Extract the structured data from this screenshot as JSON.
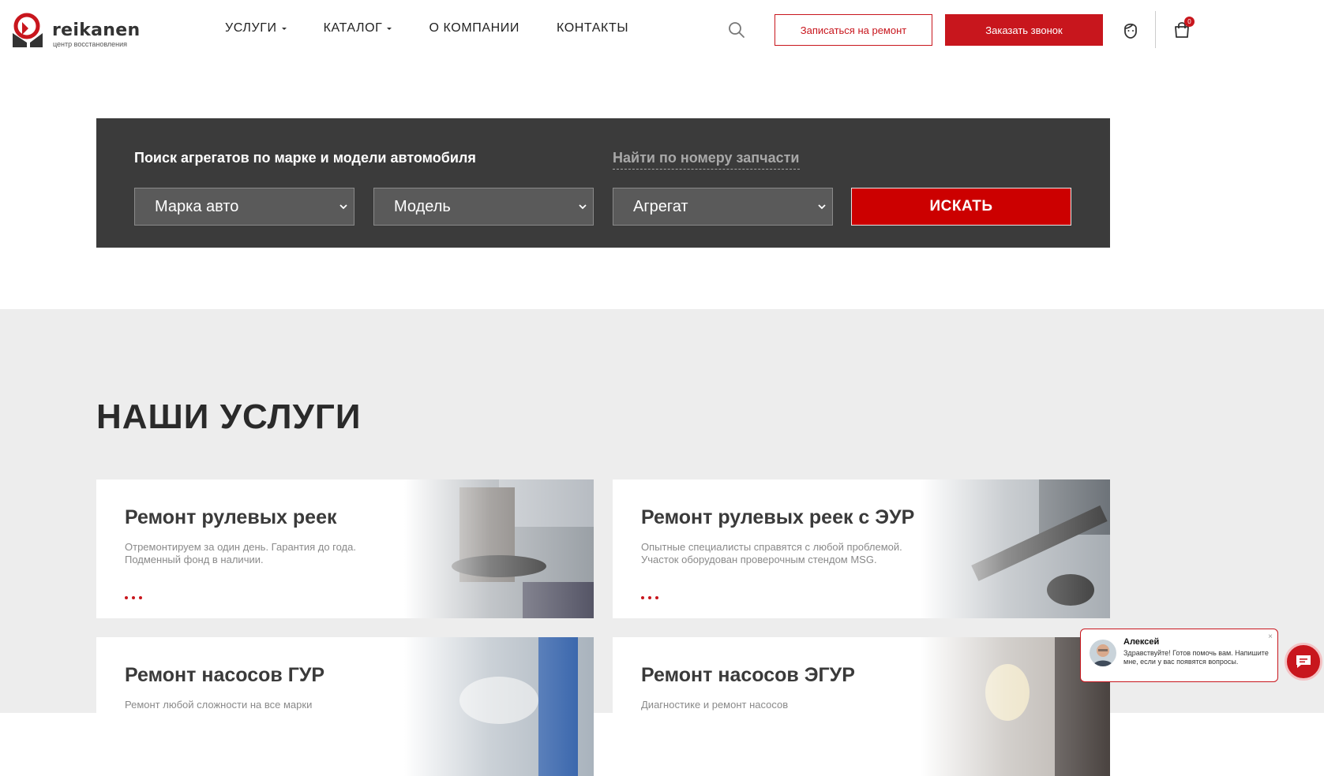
{
  "brand": {
    "name": "reikanen",
    "tagline": "центр восстановления",
    "accent_color": "#c8161d"
  },
  "nav": {
    "items": [
      {
        "label": "УСЛУГИ",
        "has_dropdown": true
      },
      {
        "label": "КАТАЛОГ",
        "has_dropdown": true
      },
      {
        "label": "О КОМПАНИИ",
        "has_dropdown": false
      },
      {
        "label": "КОНТАКТЫ",
        "has_dropdown": false
      }
    ]
  },
  "header": {
    "icons": [
      "search-icon",
      "user-icon",
      "cart-icon"
    ],
    "repair_button": "Записаться на ремонт",
    "callback_button": "Заказать звонок",
    "cart_count": "0"
  },
  "search_panel": {
    "title": "Поиск агрегатов по марке и модели автомобиля",
    "part_number_link": "Найти по номеру запчасти",
    "selects": {
      "brand": "Марка авто",
      "model": "Модель",
      "unit": "Агрегат"
    },
    "submit": "ИСКАТЬ"
  },
  "services": {
    "title": "НАШИ УСЛУГИ",
    "cards": [
      {
        "title": "Ремонт рулевых реек",
        "text": "Отремонтируем за один день. Гарантия до  года. Подменный фонд в наличии."
      },
      {
        "title": "Ремонт рулевых реек с ЭУР",
        "text": "Опытные специалисты справятся с любой проблемой. Участок оборудован проверочным стендом MSG."
      },
      {
        "title": "Ремонт насосов ГУР",
        "text": "Ремонт любой сложности на все марки"
      },
      {
        "title": "Ремонт насосов ЭГУР",
        "text": "Диагностике и ремонт насосов"
      }
    ]
  },
  "chat": {
    "agent_name": "Алексей",
    "message": "Здравствуйте! Готов помочь вам. Напишите мне, если у вас появятся вопросы.",
    "close": "×"
  }
}
